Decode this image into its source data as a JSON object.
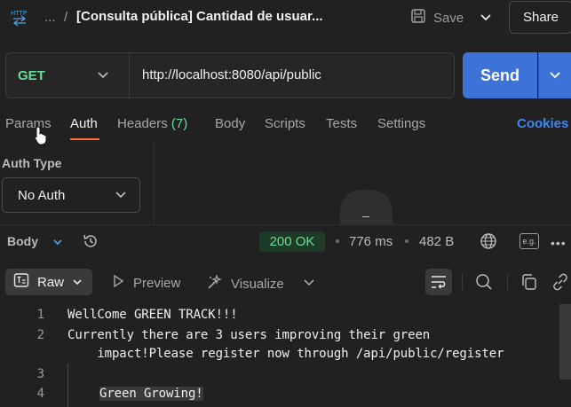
{
  "header": {
    "breadcrumb_ellipsis": "...",
    "breadcrumb_separator": "/",
    "request_title": "[Consulta pública] Cantidad de usuar...",
    "save_label": "Save",
    "share_label": "Share"
  },
  "request": {
    "method": "GET",
    "url": "http://localhost:8080/api/public",
    "send_label": "Send"
  },
  "tabs": [
    {
      "label": "Params"
    },
    {
      "label": "Auth"
    },
    {
      "label": "Headers",
      "count": "(7)"
    },
    {
      "label": "Body"
    },
    {
      "label": "Scripts"
    },
    {
      "label": "Tests"
    },
    {
      "label": "Settings"
    }
  ],
  "active_tab": "Auth",
  "cookies_label": "Cookies",
  "auth": {
    "label": "Auth Type",
    "selected": "No Auth"
  },
  "response": {
    "body_label": "Body",
    "status": "200 OK",
    "time": "776 ms",
    "size": "482 B",
    "example_badge": "e.g.",
    "more": "•••"
  },
  "viewer": {
    "raw_label": "Raw",
    "preview_label": "Preview",
    "visualize_label": "Visualize"
  },
  "code_lines": [
    {
      "num": "1",
      "text": "WellCome GREEN TRACK!!!"
    },
    {
      "num": "2",
      "text": "Currently there are 3 users improving their green"
    },
    {
      "num": "",
      "text": "    impact!Please register now through /api/public/register"
    },
    {
      "num": "3",
      "text": ""
    },
    {
      "num": "4",
      "text": "Green Growing!"
    }
  ],
  "colors": {
    "accent_orange": "#ff6c37",
    "send_blue": "#3d73d9",
    "method_green": "#6bdd9a",
    "cookies_blue": "#3d88f5",
    "background": "#212121"
  },
  "icons": [
    "http-file-icon",
    "save-icon",
    "chevron-down-icon",
    "history-icon",
    "globe-icon",
    "raw-icon",
    "play-icon",
    "visualize-icon",
    "wrap-lines-icon",
    "search-icon",
    "copy-icon",
    "link-icon",
    "pointer-cursor-icon"
  ]
}
